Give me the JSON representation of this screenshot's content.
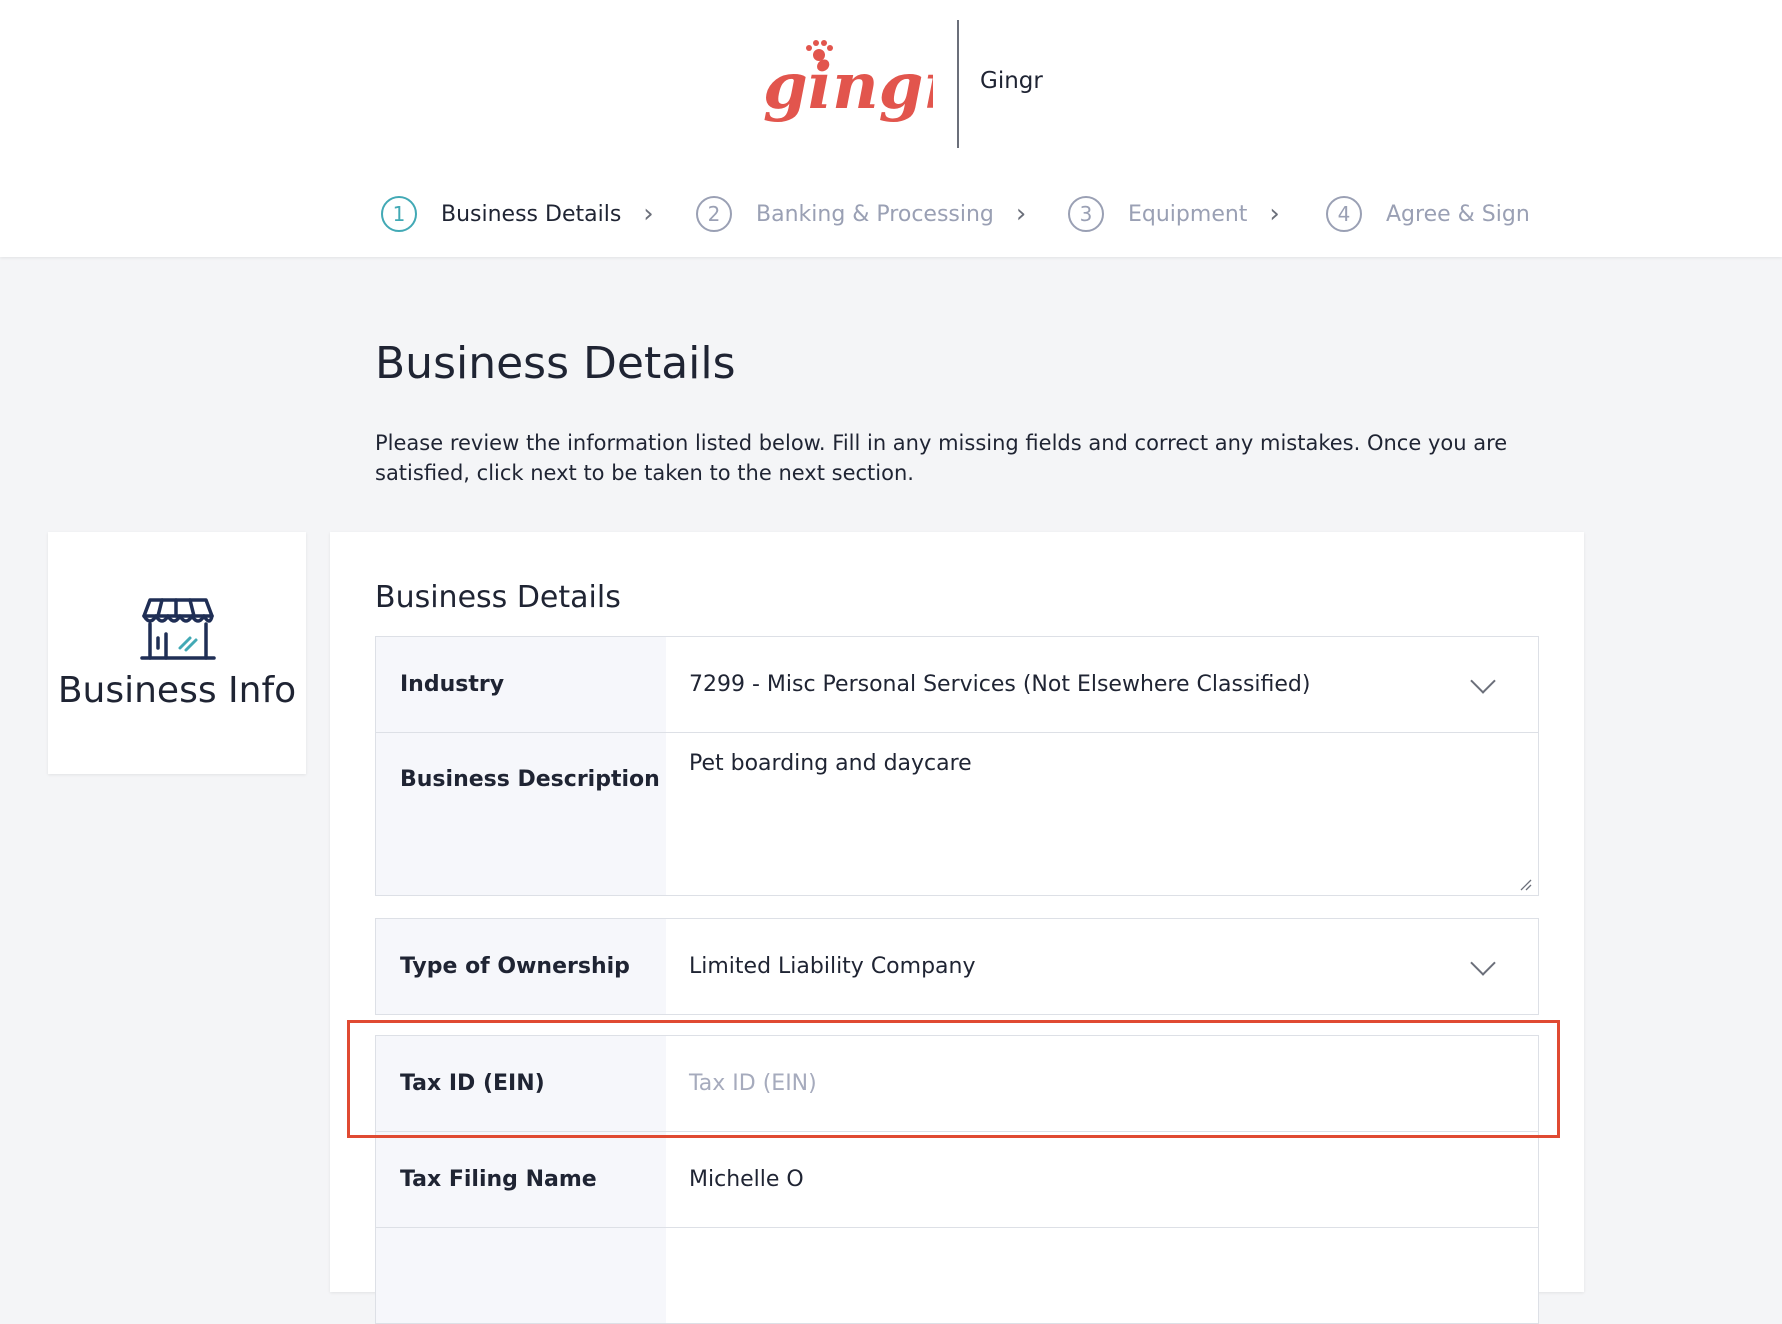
{
  "header": {
    "logo_text": "gingr",
    "company_name": "Gingr",
    "brand_color": "#e2554d"
  },
  "stepper": {
    "steps": [
      {
        "number": "1",
        "label": "Business Details",
        "active": true
      },
      {
        "number": "2",
        "label": "Banking & Processing",
        "active": false
      },
      {
        "number": "3",
        "label": "Equipment",
        "active": false
      },
      {
        "number": "4",
        "label": "Agree & Sign",
        "active": false
      }
    ],
    "active_color": "#42a9b5"
  },
  "page": {
    "title": "Business Details",
    "intro": "Please review the information listed below. Fill in any missing fields and correct any mistakes. Once you are satisfied, click next to be taken to the next section."
  },
  "sidebar": {
    "card_label": "Business Info",
    "icon": "store-icon"
  },
  "form": {
    "section_title": "Business Details",
    "fields": {
      "industry": {
        "label": "Industry",
        "value": "7299 - Misc Personal Services (Not Elsewhere Classified)"
      },
      "business_description": {
        "label": "Business Description",
        "value": "Pet boarding and daycare"
      },
      "ownership_type": {
        "label": "Type of Ownership",
        "value": "Limited Liability Company"
      },
      "tax_id": {
        "label": "Tax ID (EIN)",
        "value": "",
        "placeholder": "Tax ID (EIN)"
      },
      "tax_filing_name": {
        "label": "Tax Filing Name",
        "value": "Michelle O"
      }
    }
  },
  "annotation": {
    "highlight_color": "#e04a32"
  }
}
